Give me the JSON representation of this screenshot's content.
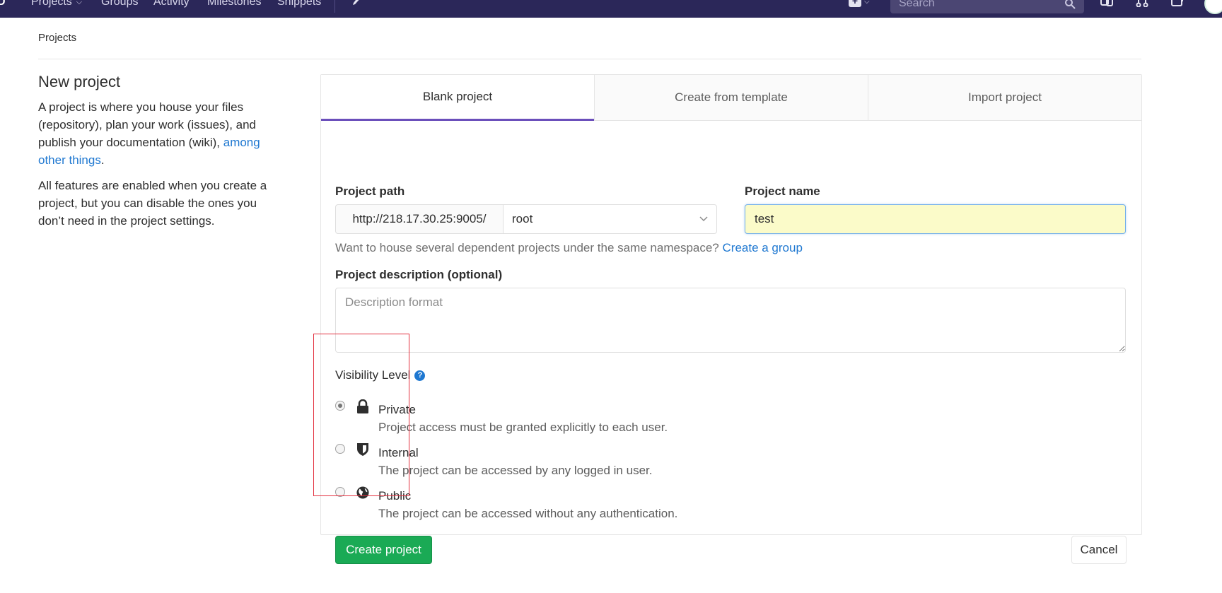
{
  "nav": {
    "logo": "D",
    "items": [
      {
        "label": "Projects",
        "has_dropdown": true
      },
      {
        "label": "Groups"
      },
      {
        "label": "Activity"
      },
      {
        "label": "Milestones"
      },
      {
        "label": "Snippets"
      }
    ],
    "search_placeholder": "Search",
    "bg_color": "#2b2759"
  },
  "breadcrumb": {
    "label": "Projects"
  },
  "intro": {
    "title": "New project",
    "para1_text": "A project is where you house your files (repository), plan your work (issues), and publish your documentation (wiki), ",
    "para1_link": "among other things",
    "para1_end": ".",
    "para2": "All features are enabled when you create a project, but you can disable the ones you don’t need in the project settings."
  },
  "tabs": [
    {
      "label": "Blank project",
      "active": true
    },
    {
      "label": "Create from template",
      "active": false
    },
    {
      "label": "Import project",
      "active": false
    }
  ],
  "form": {
    "project_path_label": "Project path",
    "path_prefix": "http://218.17.30.25:9005/",
    "namespace_value": "root",
    "project_name_label": "Project name",
    "project_name_value": "test",
    "help_text": "Want to house several dependent projects under the same namespace? ",
    "help_link": "Create a group",
    "description_label": "Project description (optional)",
    "description_placeholder": "Description format",
    "visibility_label": "Visibility Level",
    "visibility_help": "?",
    "visibility_options": [
      {
        "title": "Private",
        "description": "Project access must be granted explicitly to each user.",
        "icon": "lock-icon",
        "checked": true
      },
      {
        "title": "Internal",
        "description": "The project can be accessed by any logged in user.",
        "icon": "shield-icon",
        "checked": false
      },
      {
        "title": "Public",
        "description": "The project can be accessed without any authentication.",
        "icon": "globe-icon",
        "checked": false
      }
    ],
    "create_button": "Create project",
    "cancel_button": "Cancel"
  },
  "colors": {
    "accent_tab": "#6b4fbb",
    "link": "#1f78d1",
    "create_button": "#1aaa55",
    "name_input_bg": "#fbfbc9",
    "annotation_box": "#e3303f"
  }
}
